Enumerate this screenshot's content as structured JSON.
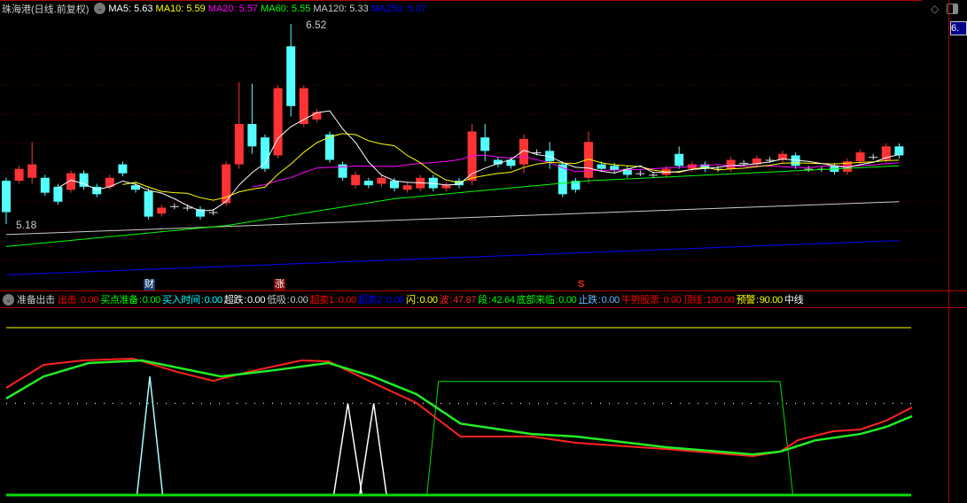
{
  "header": {
    "title": "珠海港(日线.前复权)",
    "ma": [
      {
        "label": "MA5: 5.63",
        "color": "#ffffff"
      },
      {
        "label": "MA10: 5.59",
        "color": "#ffff00"
      },
      {
        "label": "MA20: 5.57",
        "color": "#ff00ff"
      },
      {
        "label": "MA60: 5.55",
        "color": "#00ff00"
      },
      {
        "label": "MA120: 5.33",
        "color": "#cccccc"
      },
      {
        "label": "MA250: 5.07",
        "color": "#0000ff"
      }
    ]
  },
  "price_box": "6.",
  "high_label": "6.52",
  "low_label": "5.18",
  "markers": {
    "cai": "财",
    "zhang": "涨",
    "s": "S"
  },
  "indicator": {
    "name": "准备出击",
    "items": [
      {
        "label": "出击",
        "value": "0.00",
        "color": "#ff0000"
      },
      {
        "label": "买点准备",
        "value": "0.00",
        "color": "#00ff00"
      },
      {
        "label": "买入时间",
        "value": "0.00",
        "color": "#00ffff"
      },
      {
        "label": "超跌",
        "value": "0.00",
        "color": "#ffffff"
      },
      {
        "label": "低吸",
        "value": "0.00",
        "color": "#cccccc"
      },
      {
        "label": "超卖1",
        "value": "0.00",
        "color": "#ff0000"
      },
      {
        "label": "超卖2",
        "value": "0.00",
        "color": "#0000ff"
      },
      {
        "label": "闪",
        "value": "0.00",
        "color": "#ffff00"
      },
      {
        "label": "波",
        "value": "47.87",
        "color": "#ff2222"
      },
      {
        "label": "段",
        "value": "42.64",
        "color": "#00ff00"
      },
      {
        "label": "底部来临",
        "value": "0.00",
        "color": "#00ff00"
      },
      {
        "label": "止跌",
        "value": "0.00",
        "color": "#66bbff"
      },
      {
        "label": "牛势股票",
        "value": "0.00",
        "color": "#ff0000"
      },
      {
        "label": "顶线",
        "value": "100.00",
        "color": "#ff0000"
      },
      {
        "label": "预警",
        "value": "90.00",
        "color": "#ffff00"
      },
      {
        "label": "中线",
        "value": "",
        "color": "#ffffff"
      }
    ]
  },
  "colors": {
    "up": "#ff3333",
    "down": "#54ffff"
  },
  "chart_data": {
    "type": "candlestick",
    "price_range": [
      5.18,
      6.52
    ],
    "candles": [
      [
        5.47,
        5.26,
        5.49,
        5.18
      ],
      [
        5.47,
        5.55
      ],
      [
        5.49,
        5.58,
        5.73,
        5.45
      ],
      [
        5.49,
        5.39
      ],
      [
        5.43,
        5.33
      ],
      [
        5.41,
        5.52
      ],
      [
        5.52,
        5.43
      ],
      [
        5.43,
        5.38
      ],
      [
        5.43,
        5.49
      ],
      [
        5.58,
        5.52
      ],
      [
        5.44,
        5.41
      ],
      [
        5.4,
        5.23
      ],
      [
        5.25,
        5.29
      ],
      [
        5.3,
        5.3
      ],
      [
        5.29,
        5.29
      ],
      [
        5.28,
        5.23
      ],
      [
        5.26,
        5.26
      ],
      [
        5.32,
        5.58
      ],
      [
        5.58,
        5.85,
        6.13,
        5.55
      ],
      [
        5.85,
        5.7,
        6.12,
        5.65
      ],
      [
        5.76,
        5.55
      ],
      [
        5.64,
        6.09
      ],
      [
        6.37,
        5.97,
        6.52,
        5.9
      ],
      [
        5.85,
        6.09
      ],
      [
        5.88,
        5.93
      ],
      [
        5.78,
        5.61
      ],
      [
        5.58,
        5.49
      ],
      [
        5.44,
        5.51
      ],
      [
        5.47,
        5.44
      ],
      [
        5.45,
        5.49
      ],
      [
        5.47,
        5.42
      ],
      [
        5.41,
        5.44
      ],
      [
        5.42,
        5.49
      ],
      [
        5.49,
        5.42
      ],
      [
        5.42,
        5.44
      ],
      [
        5.47,
        5.44
      ],
      [
        5.47,
        5.8,
        5.85,
        5.44
      ],
      [
        5.76,
        5.67,
        5.85,
        5.6
      ],
      [
        5.61,
        5.58
      ],
      [
        5.61,
        5.57
      ],
      [
        5.58,
        5.75,
        5.78,
        5.52
      ],
      [
        5.66,
        5.66
      ],
      [
        5.67,
        5.6,
        5.73,
        5.55
      ],
      [
        5.58,
        5.38
      ],
      [
        5.47,
        5.41
      ],
      [
        5.49,
        5.73,
        5.8,
        5.45
      ],
      [
        5.58,
        5.55
      ],
      [
        5.57,
        5.54
      ],
      [
        5.55,
        5.51
      ],
      [
        5.52,
        5.52
      ],
      [
        5.51,
        5.51
      ],
      [
        5.51,
        5.55
      ],
      [
        5.65,
        5.57,
        5.7,
        5.55
      ],
      [
        5.55,
        5.58
      ],
      [
        5.58,
        5.55
      ],
      [
        5.55,
        5.55
      ],
      [
        5.55,
        5.61
      ],
      [
        5.59,
        5.59
      ],
      [
        5.58,
        5.62
      ],
      [
        5.61,
        5.61
      ],
      [
        5.61,
        5.65
      ],
      [
        5.64,
        5.57
      ],
      [
        5.55,
        5.55
      ],
      [
        5.55,
        5.55
      ],
      [
        5.57,
        5.53
      ],
      [
        5.53,
        5.6
      ],
      [
        5.6,
        5.66
      ],
      [
        5.63,
        5.63
      ],
      [
        5.61,
        5.7
      ],
      [
        5.7,
        5.64
      ]
    ],
    "ma60": [
      [
        0,
        5.03
      ],
      [
        17,
        5.17
      ],
      [
        30,
        5.35
      ],
      [
        45,
        5.47
      ],
      [
        69,
        5.57
      ]
    ],
    "ma120": [
      [
        0,
        5.11
      ],
      [
        69,
        5.33
      ]
    ],
    "ma250": [
      [
        0,
        4.84
      ],
      [
        69,
        5.07
      ]
    ],
    "indicator_range": [
      0,
      100
    ],
    "bo": [
      [
        0,
        64.2
      ],
      [
        2.9,
        77.9
      ],
      [
        5.9,
        80.5
      ],
      [
        9.8,
        81.6
      ],
      [
        13.2,
        73.7
      ],
      [
        16,
        68.4
      ],
      [
        18.7,
        73.7
      ],
      [
        22.8,
        80.5
      ],
      [
        24.9,
        80
      ],
      [
        28.3,
        67.4
      ],
      [
        31.7,
        55.3
      ],
      [
        35.1,
        35.3
      ],
      [
        40.6,
        35.3
      ],
      [
        44,
        31.6
      ],
      [
        50.9,
        27.9
      ],
      [
        57.7,
        23.7
      ],
      [
        59.8,
        26.3
      ],
      [
        61.2,
        33.2
      ],
      [
        63.9,
        38.4
      ],
      [
        66,
        39.5
      ],
      [
        68,
        44.7
      ],
      [
        70,
        52.6
      ]
    ],
    "duan": [
      [
        0,
        57.9
      ],
      [
        2.9,
        71
      ],
      [
        6.4,
        79
      ],
      [
        10.5,
        80.5
      ],
      [
        16.6,
        71
      ],
      [
        20.7,
        74.7
      ],
      [
        24.9,
        79
      ],
      [
        28.3,
        71
      ],
      [
        31.7,
        60.5
      ],
      [
        35.1,
        43
      ],
      [
        40.6,
        36.8
      ],
      [
        44,
        35.3
      ],
      [
        50.9,
        29
      ],
      [
        57.7,
        24.7
      ],
      [
        59.8,
        26.3
      ],
      [
        62.5,
        33
      ],
      [
        66,
        36.8
      ],
      [
        68,
        41
      ],
      [
        70,
        47.4
      ]
    ],
    "bottom_signal": [
      [
        32.5,
        0
      ],
      [
        33.4,
        68
      ],
      [
        59.8,
        68
      ],
      [
        60.8,
        0
      ]
    ],
    "spikes": [
      [
        10.1,
        11.1,
        12.1,
        71
      ],
      [
        25.3,
        26.4,
        27.5,
        55
      ],
      [
        27.3,
        28.4,
        29.4,
        55
      ]
    ],
    "top_line": 100,
    "warn_line": 55
  }
}
